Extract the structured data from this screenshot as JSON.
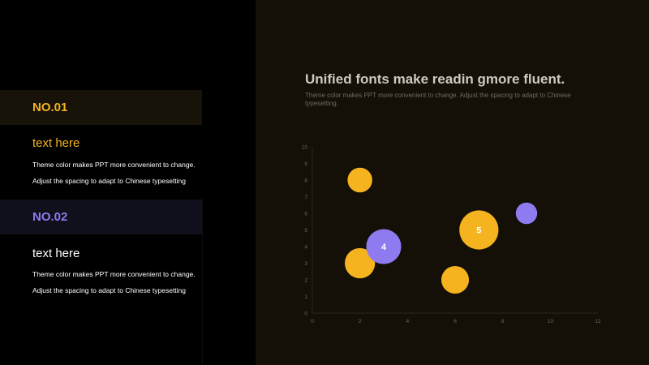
{
  "sidebar": {
    "items": [
      {
        "number": "NO.01",
        "subtitle": "text here",
        "line1": "Theme color makes PPT more convenient to change.",
        "line2": "Adjust the spacing to adapt to Chinese typesetting"
      },
      {
        "number": "NO.02",
        "subtitle": "text here",
        "line1": "Theme color makes PPT more convenient to change.",
        "line2": "Adjust the spacing to adapt to Chinese typesetting"
      }
    ]
  },
  "main": {
    "title": "Unified fonts make readin gmore fluent.",
    "description": "Theme color makes PPT more convenient to change. Adjust the spacing to adapt to Chinese typesetting."
  },
  "colors": {
    "gold": "#f5b31f",
    "purple": "#8e7bf0"
  },
  "chart_data": {
    "type": "scatter",
    "title": "",
    "xlabel": "",
    "ylabel": "",
    "xlim": [
      0,
      12
    ],
    "ylim": [
      0,
      10
    ],
    "xticks": [
      0,
      2,
      4,
      6,
      8,
      10,
      12
    ],
    "yticks": [
      0,
      1,
      2,
      3,
      4,
      5,
      6,
      7,
      8,
      9,
      10
    ],
    "grid": false,
    "series": [
      {
        "color": "#f5b31f",
        "points": [
          {
            "x": 2,
            "y": 8,
            "size": 2
          },
          {
            "x": 2,
            "y": 3,
            "size": 3
          },
          {
            "x": 6,
            "y": 2,
            "size": 2.5
          },
          {
            "x": 7,
            "y": 5,
            "size": 5,
            "label": "5"
          }
        ]
      },
      {
        "color": "#8e7bf0",
        "points": [
          {
            "x": 3,
            "y": 4,
            "size": 4,
            "label": "4"
          },
          {
            "x": 9,
            "y": 6,
            "size": 1.5
          }
        ]
      }
    ]
  }
}
